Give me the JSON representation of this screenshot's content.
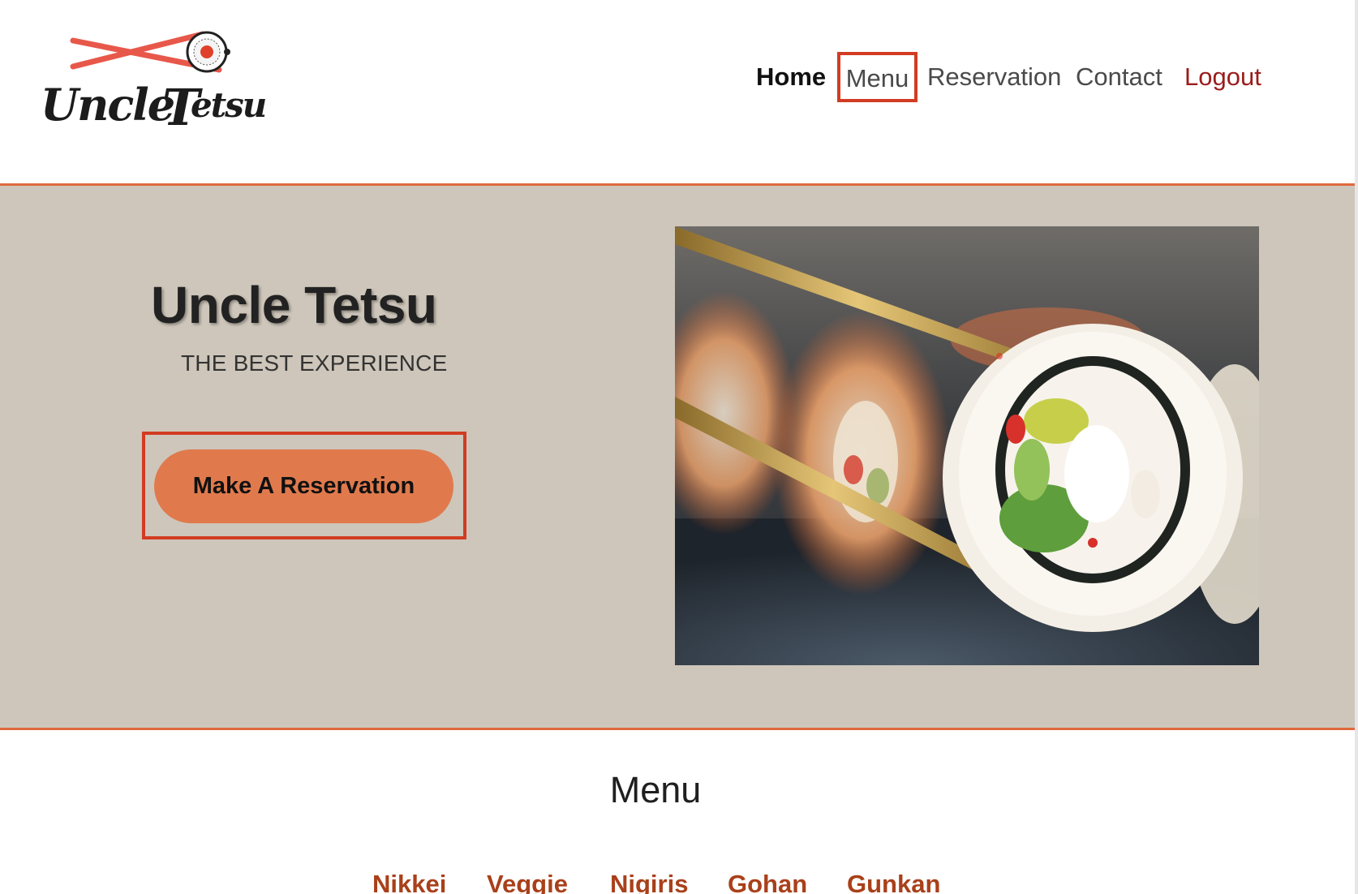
{
  "brand": {
    "logo_text": "Uncle Tetsu",
    "accent_color": "#e0693e",
    "hero_bg_color": "#cec6ba",
    "button_color": "#e07a4d",
    "highlight_color": "#d23c23",
    "logout_color": "#9b1c1c",
    "category_color": "#a9401a"
  },
  "nav": {
    "items": [
      {
        "label": "Home",
        "active": true
      },
      {
        "label": "Menu",
        "highlighted": true
      },
      {
        "label": "Reservation"
      },
      {
        "label": "Contact"
      },
      {
        "label": "Logout"
      }
    ]
  },
  "hero": {
    "title": "Uncle Tetsu",
    "subtitle": "THE BEST EXPERIENCE",
    "cta_label": "Make A Reservation",
    "image_icon": "sushi-roll-photo"
  },
  "menu": {
    "heading": "Menu",
    "categories": [
      "Nikkei",
      "Veggie",
      "Nigiris",
      "Gohan",
      "Gunkan"
    ]
  }
}
